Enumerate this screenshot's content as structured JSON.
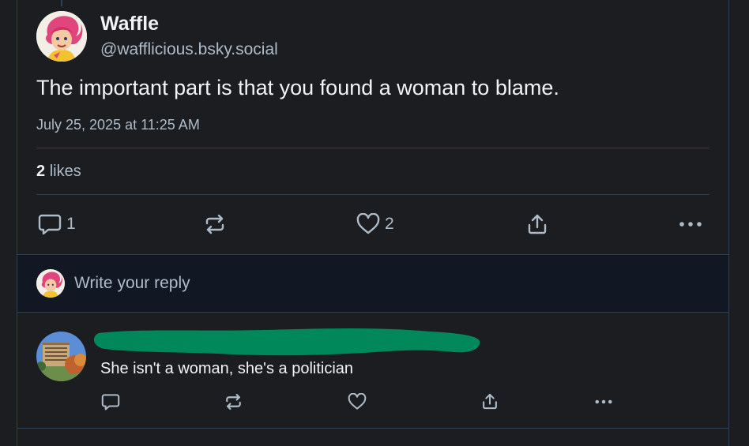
{
  "post": {
    "author_name": "Waffle",
    "author_handle": "@wafflicious.bsky.social",
    "text": "The important part is that you found a woman to blame.",
    "timestamp": "July 25, 2025 at 11:25 AM",
    "likes_count": "2",
    "likes_label": "likes",
    "actions": {
      "reply_icon": "reply-icon",
      "reply_count": "1",
      "repost_icon": "repost-icon",
      "like_icon": "heart-icon",
      "like_count": "2",
      "share_icon": "share-icon",
      "more_icon": "more-icon"
    }
  },
  "composer": {
    "placeholder": "Write your reply"
  },
  "reply": {
    "author_redacted": true,
    "text": "She isn't a woman, she's a politician",
    "actions": {
      "reply_icon": "reply-icon",
      "repost_icon": "repost-icon",
      "like_icon": "heart-icon",
      "share_icon": "share-icon",
      "more_icon": "more-icon"
    }
  },
  "colors": {
    "background": "#1b1d20",
    "composer_background": "#111823",
    "border": "#2e4052",
    "text_primary": "#f1f3f5",
    "text_secondary": "#aebbc9",
    "redaction": "#00875a"
  }
}
